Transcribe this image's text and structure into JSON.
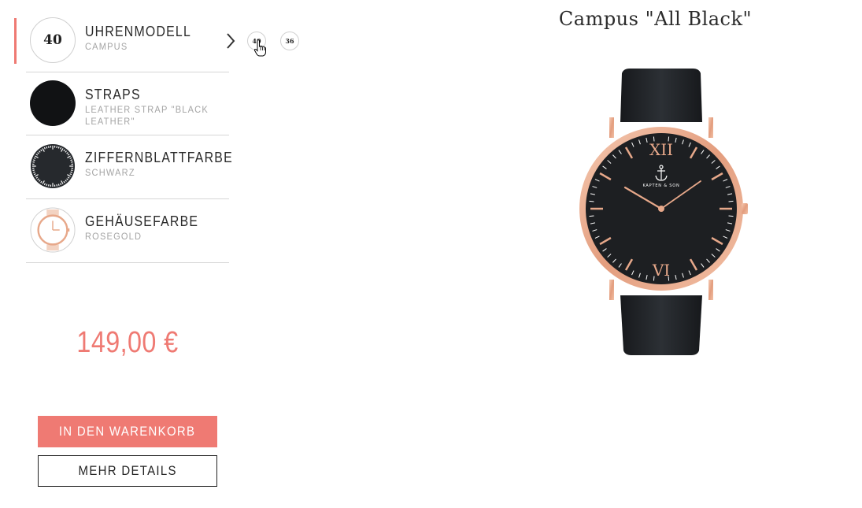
{
  "config": {
    "rows": [
      {
        "title": "UHRENMODELL",
        "subtitle": "CAMPUS",
        "thumb_text": "40"
      },
      {
        "title": "STRAPS",
        "subtitle": "LEATHER STRAP \"BLACK LEATHER\""
      },
      {
        "title": "ZIFFERNBLATTFARBE",
        "subtitle": "SCHWARZ"
      },
      {
        "title": "GEHÄUSEFARBE",
        "subtitle": "ROSEGOLD"
      }
    ],
    "size_options": [
      "40",
      "36"
    ]
  },
  "price": "149,00 €",
  "buttons": {
    "add_to_cart": "IN DEN WARENKORB",
    "more_details": "MEHR DETAILS"
  },
  "product": {
    "title": "Campus \"All Black\"",
    "dial_brand": "KAPTEN & SON",
    "numerals": {
      "top": "XII",
      "bottom": "VI"
    }
  },
  "colors": {
    "accent": "#ef7a73",
    "rose_gold": "#e7a88a",
    "dial": "#1d1f22",
    "strap": "#202326"
  },
  "icons": {
    "chevron": "chevron-right-icon",
    "cursor": "hand-pointer-icon"
  }
}
